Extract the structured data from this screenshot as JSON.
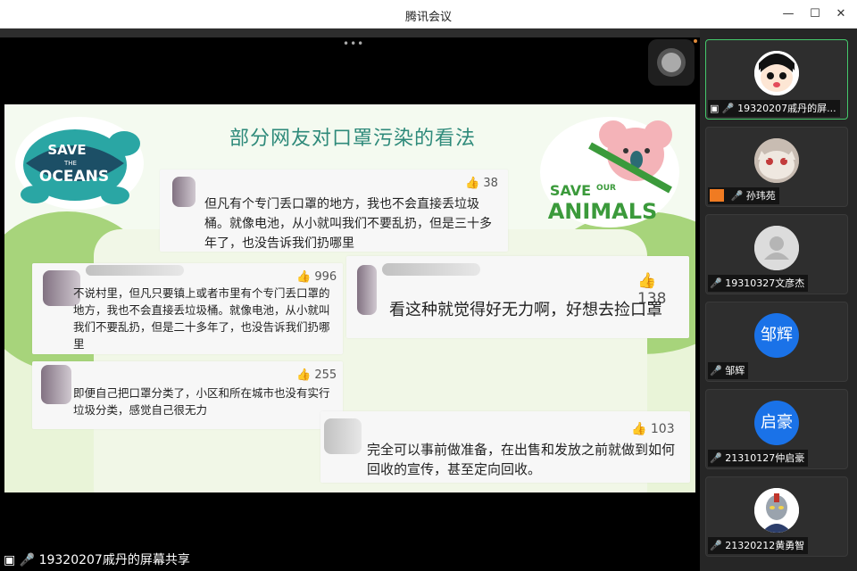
{
  "window": {
    "title": "腾讯会议"
  },
  "slide": {
    "title": "部分网友对口罩污染的看法",
    "comments": [
      {
        "likes": "38",
        "text": "但凡有个专门丢口罩的地方，我也不会直接丢垃圾桶。就像电池，从小就叫我们不要乱扔，但是三十多年了，也没告诉我们扔哪里"
      },
      {
        "likes": "996",
        "text": "不说村里，但凡只要镇上或者市里有个专门丢口罩的地方，我也不会直接丢垃圾桶。就像电池，从小就叫我们不要乱扔，但是二十多年了，也没告诉我们扔哪里"
      },
      {
        "likes": "255",
        "text": "即便自己把口罩分类了，小区和所在城市也没有实行垃圾分类，感觉自己很无力"
      },
      {
        "likes": "138",
        "text": "看这种就觉得好无力啊，好想去捡口罩"
      },
      {
        "likes": "103",
        "text": "完全可以事前做准备，在出售和发放之前就做到如何回收的宣传，甚至定向回收。"
      }
    ],
    "sticker_left": {
      "line1": "SAVE",
      "line2": "THE",
      "line3": "OCEANS"
    },
    "sticker_right": {
      "line1": "SAVE",
      "line2": "OUR",
      "line3": "ANIMALS"
    }
  },
  "participants": [
    {
      "name": "19320207戚丹的屏...",
      "avatar_text": ""
    },
    {
      "name": "孙玮苑",
      "avatar_text": ""
    },
    {
      "name": "19310327文彦杰",
      "avatar_text": ""
    },
    {
      "name": "邹辉",
      "avatar_text": "邹辉"
    },
    {
      "name": "21310127仲启豪",
      "avatar_text": "启豪"
    },
    {
      "name": "21320212黄勇智",
      "avatar_text": ""
    }
  ],
  "share_label": "19320207戚丹的屏幕共享",
  "colors": {
    "accent_green": "#45c96c",
    "avatar_blue": "#1a72e8",
    "title_teal": "#2e8a7a"
  }
}
